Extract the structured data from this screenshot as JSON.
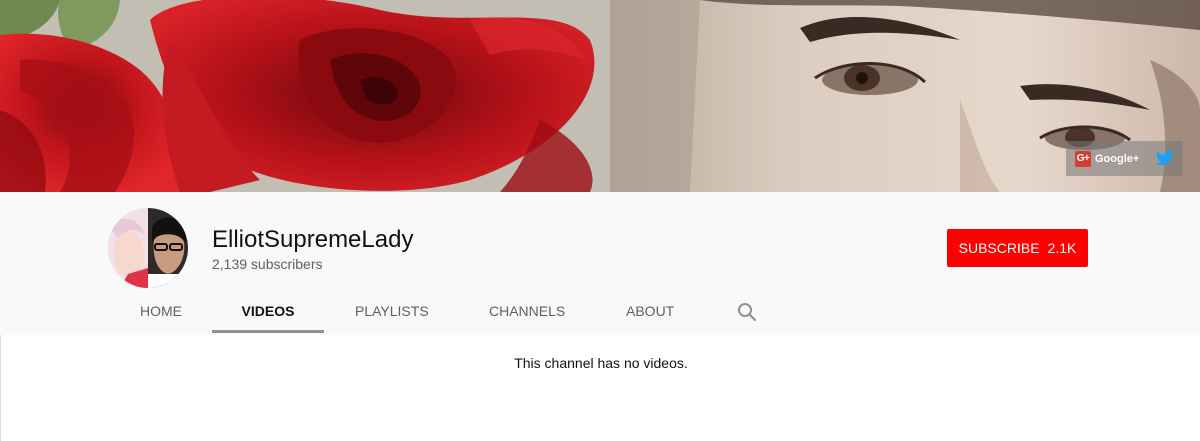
{
  "channel": {
    "name": "ElliotSupremeLady",
    "subscribers": "2,139 subscribers"
  },
  "subscribe": {
    "label": "SUBSCRIBE",
    "count": "2.1K",
    "color": "#ff0000"
  },
  "social": {
    "googleplus": {
      "icon": "google-plus-icon",
      "icon_text": "G+",
      "label": "Google+"
    },
    "twitter": {
      "icon": "twitter-icon"
    }
  },
  "tabs": [
    {
      "label": "HOME",
      "active": false
    },
    {
      "label": "VIDEOS",
      "active": true
    },
    {
      "label": "PLAYLISTS",
      "active": false
    },
    {
      "label": "CHANNELS",
      "active": false
    },
    {
      "label": "ABOUT",
      "active": false
    }
  ],
  "search": {
    "icon": "search-icon"
  },
  "content": {
    "empty_message": "This channel has no videos."
  }
}
